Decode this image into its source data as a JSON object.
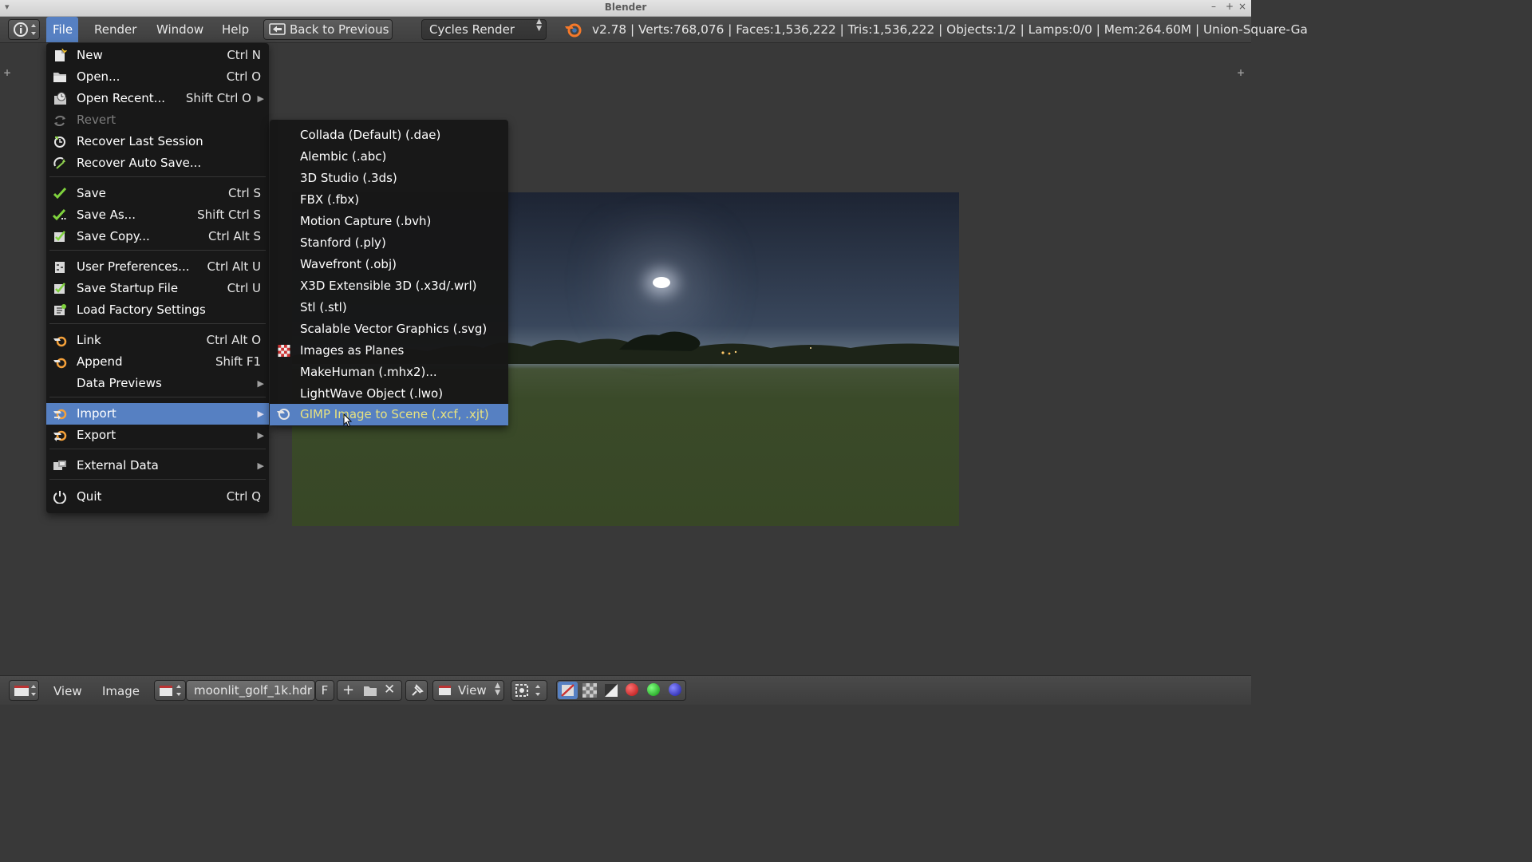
{
  "window": {
    "title": "Blender"
  },
  "header": {
    "menus": [
      "File",
      "Render",
      "Window",
      "Help"
    ],
    "back_button": "Back to Previous",
    "render_engine": "Cycles Render",
    "stats": "v2.78 | Verts:768,076 | Faces:1,536,222 | Tris:1,536,222 | Objects:1/2 | Lamps:0/0 | Mem:264.60M | Union-Square-Ga"
  },
  "file_menu": {
    "items": [
      {
        "label": "New",
        "shortcut": "Ctrl N",
        "icon": "new-file-icon"
      },
      {
        "label": "Open...",
        "shortcut": "Ctrl O",
        "icon": "folder-icon"
      },
      {
        "label": "Open Recent...",
        "shortcut": "Shift Ctrl O",
        "icon": "recent-icon",
        "submenu": true
      },
      {
        "label": "Revert",
        "shortcut": "",
        "icon": "revert-icon",
        "disabled": true
      },
      {
        "label": "Recover Last Session",
        "shortcut": "",
        "icon": "recover-icon"
      },
      {
        "label": "Recover Auto Save...",
        "shortcut": "",
        "icon": "recover-auto-icon"
      },
      {
        "label": "Save",
        "shortcut": "Ctrl S",
        "icon": "save-check-icon"
      },
      {
        "label": "Save As...",
        "shortcut": "Shift Ctrl S",
        "icon": "save-as-icon"
      },
      {
        "label": "Save Copy...",
        "shortcut": "Ctrl Alt S",
        "icon": "save-copy-icon"
      },
      {
        "label": "User Preferences...",
        "shortcut": "Ctrl Alt U",
        "icon": "preferences-icon"
      },
      {
        "label": "Save Startup File",
        "shortcut": "Ctrl U",
        "icon": "save-startup-icon"
      },
      {
        "label": "Load Factory Settings",
        "shortcut": "",
        "icon": "load-factory-icon"
      },
      {
        "label": "Link",
        "shortcut": "Ctrl Alt O",
        "icon": "link-icon"
      },
      {
        "label": "Append",
        "shortcut": "Shift F1",
        "icon": "append-icon"
      },
      {
        "label": "Data Previews",
        "shortcut": "",
        "icon": "",
        "submenu": true
      },
      {
        "label": "Import",
        "shortcut": "",
        "icon": "import-icon",
        "submenu": true,
        "highlighted": true
      },
      {
        "label": "Export",
        "shortcut": "",
        "icon": "export-icon",
        "submenu": true
      },
      {
        "label": "External Data",
        "shortcut": "",
        "icon": "external-data-icon",
        "submenu": true
      },
      {
        "label": "Quit",
        "shortcut": "Ctrl Q",
        "icon": "power-icon"
      }
    ]
  },
  "import_submenu": {
    "items": [
      {
        "label": "Collada (Default) (.dae)"
      },
      {
        "label": "Alembic (.abc)"
      },
      {
        "label": "3D Studio (.3ds)"
      },
      {
        "label": "FBX (.fbx)"
      },
      {
        "label": "Motion Capture (.bvh)"
      },
      {
        "label": "Stanford (.ply)"
      },
      {
        "label": "Wavefront (.obj)"
      },
      {
        "label": "X3D Extensible 3D (.x3d/.wrl)"
      },
      {
        "label": "Stl (.stl)"
      },
      {
        "label": "Scalable Vector Graphics (.svg)"
      },
      {
        "label": "Images as Planes",
        "icon": "checker-icon"
      },
      {
        "label": "MakeHuman (.mhx2)..."
      },
      {
        "label": "LightWave Object (.lwo)"
      },
      {
        "label": "GIMP Image to Scene (.xcf, .xjt)",
        "icon": "gimp-icon",
        "highlighted": true
      }
    ]
  },
  "footer": {
    "view_label": "View",
    "image_label": "Image",
    "image_name": "moonlit_golf_1k.hdr",
    "fake_user": "F",
    "view_dropdown": "View"
  },
  "colors": {
    "highlight": "#5680c2",
    "highlight_text": "#e8e27f",
    "menu_bg": "#171717",
    "editor_bg": "#393939"
  }
}
